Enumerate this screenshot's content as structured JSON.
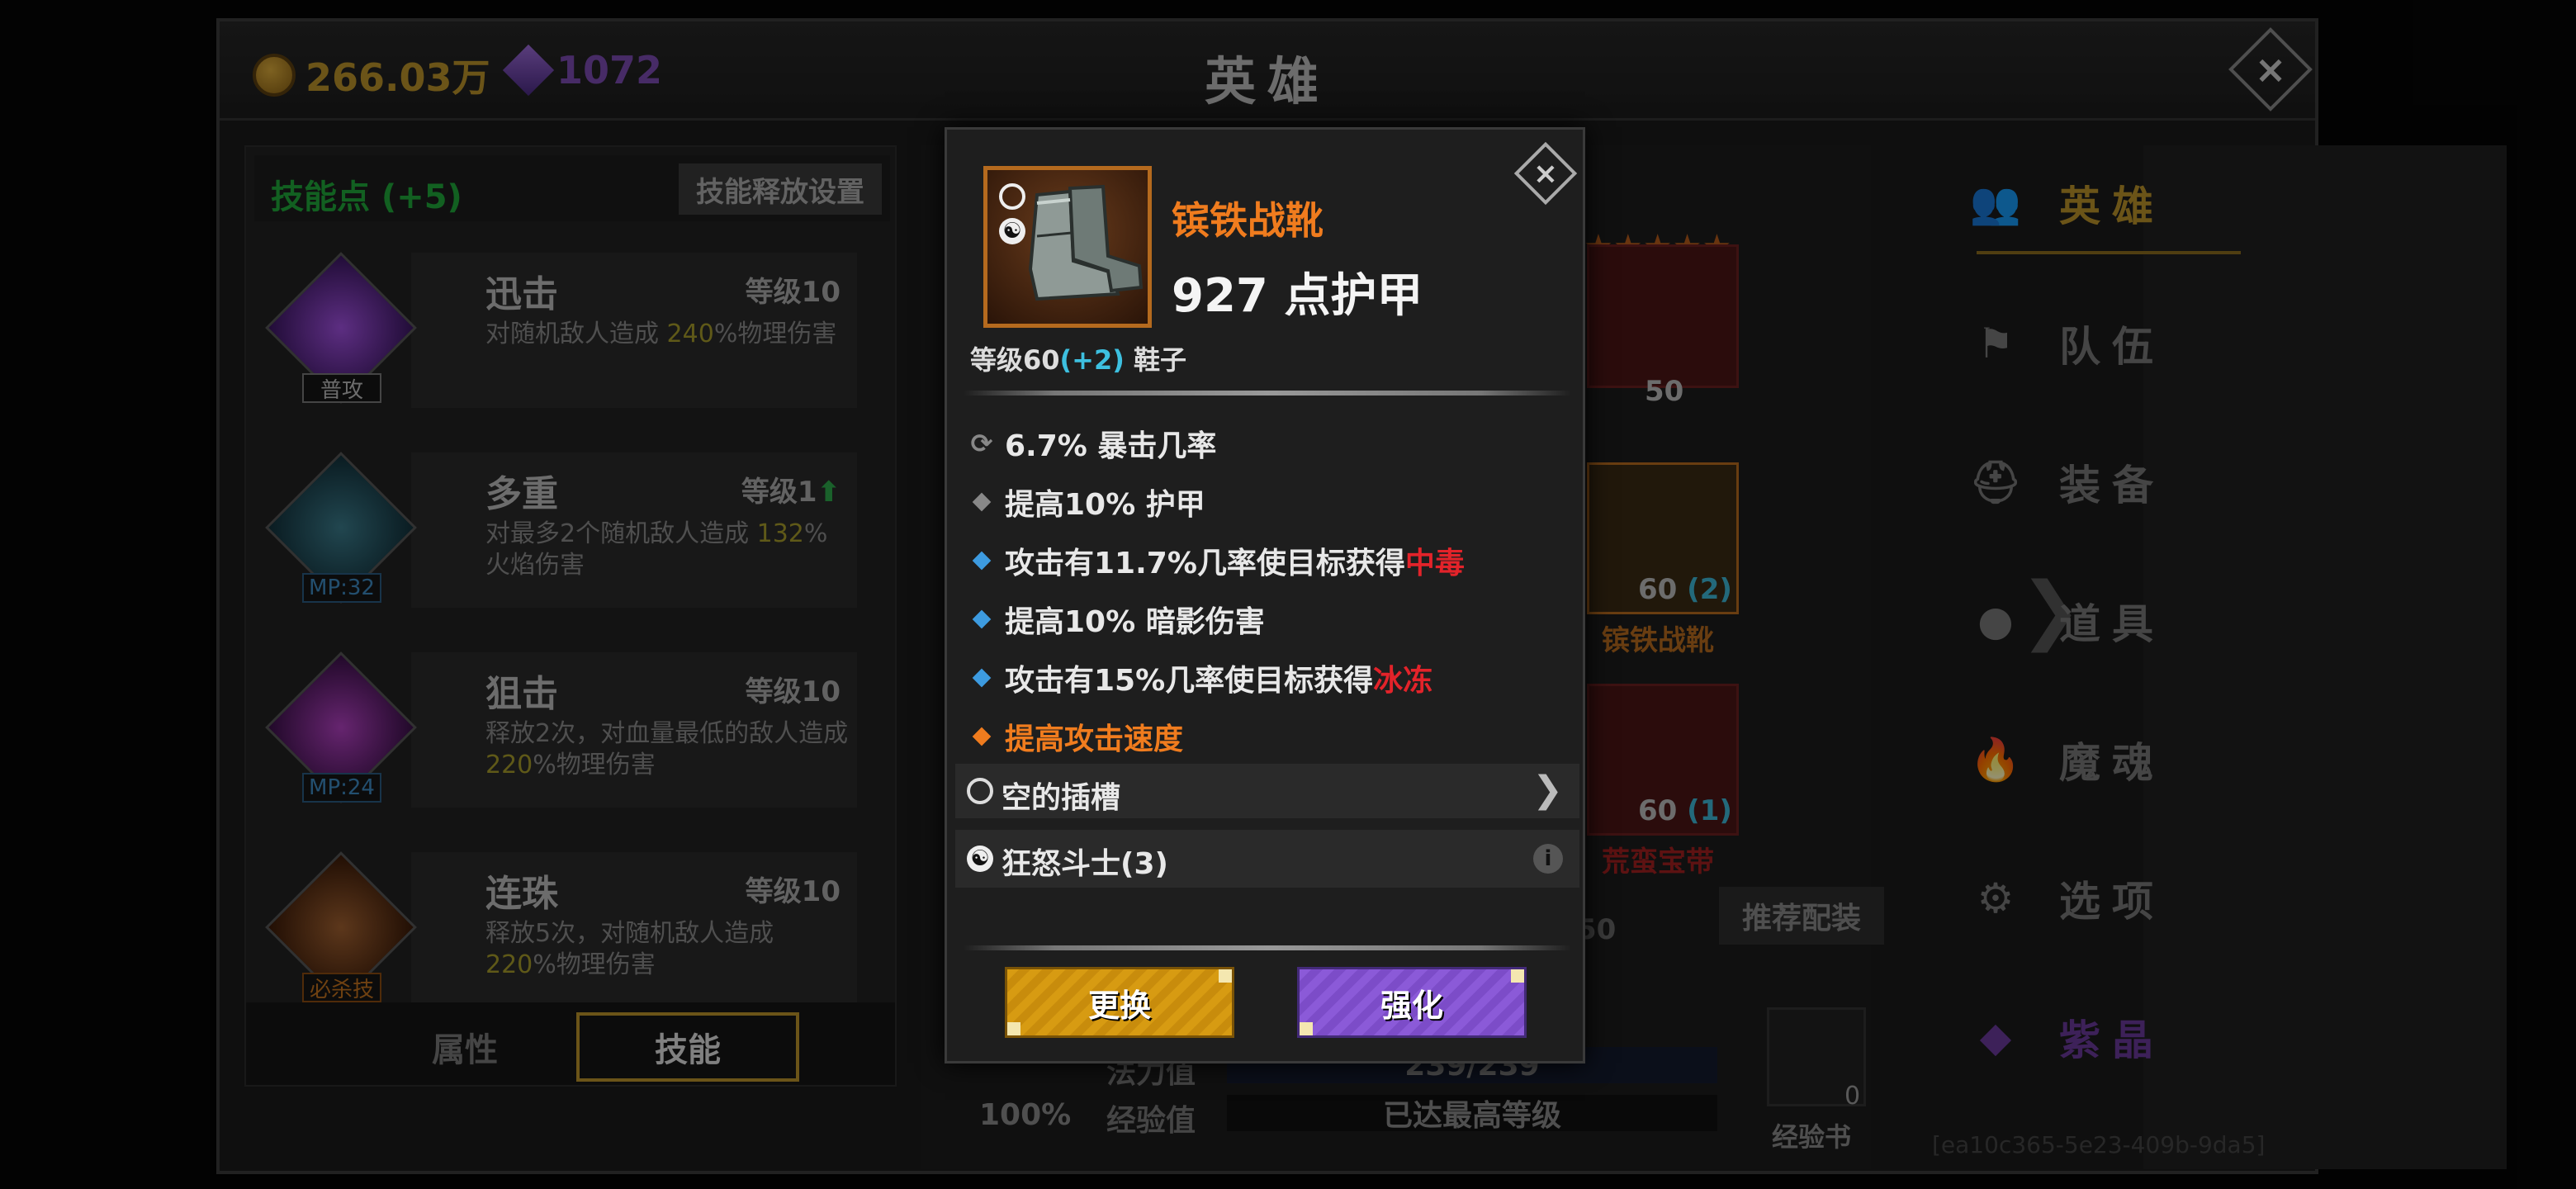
{
  "header": {
    "gold": "266.03万",
    "gems": "1072",
    "title": "英雄",
    "close": "×"
  },
  "left_panel": {
    "skill_points": "技能点 (+5)",
    "release_settings": "技能释放设置",
    "skills": [
      {
        "name": "迅击",
        "level": "等级10",
        "desc_pre": "对随机敌人造成 ",
        "desc_num": "240",
        "desc_post": "%物理伤害",
        "tag": "普攻",
        "color": "#8a3acc"
      },
      {
        "name": "多重",
        "level": "等级1",
        "desc_pre": "对最多2个随机敌人造成 ",
        "desc_num": "132",
        "desc_post": "%火焰伤害",
        "tag": "MP:32",
        "color": "#2a5a6a"
      },
      {
        "name": "狙击",
        "level": "等级10",
        "desc_pre": "释放2次，对血量最低的敌人造成 ",
        "desc_num": "220",
        "desc_post": "%物理伤害",
        "tag": "MP:24",
        "color": "#8a2aa0"
      },
      {
        "name": "连珠",
        "level": "等级10",
        "desc_pre": "释放5次，对随机敌人造成 ",
        "desc_num": "220",
        "desc_post": "%物理伤害",
        "tag": "必杀技",
        "color": "#8a4a1a"
      }
    ],
    "tabs": [
      "属性",
      "技能"
    ]
  },
  "middle": {
    "hero_level": "50",
    "boots_level": "60",
    "boots_bonus": "(2)",
    "boots_name": "镔铁战靴",
    "belt_level": "60",
    "belt_bonus": "(1)",
    "belt_name": "荒蛮宝带",
    "recommend": "推荐配装",
    "partial_level": "50",
    "mana_label": "法力值",
    "mana_value": "239/239",
    "exp_label": "经验值",
    "exp_value": "已达最高等级",
    "percent": "100%",
    "exp_book_label": "经验书",
    "exp_book_count": "0"
  },
  "right_nav": [
    {
      "label": "英雄",
      "icon": "👥",
      "active": true
    },
    {
      "label": "队伍",
      "icon": "⚑",
      "active": false
    },
    {
      "label": "装备",
      "icon": "⛑",
      "active": false
    },
    {
      "label": "道具",
      "icon": "●",
      "active": false
    },
    {
      "label": "魔魂",
      "icon": "🔥",
      "active": false
    },
    {
      "label": "选项",
      "icon": "⚙",
      "active": false
    },
    {
      "label": "紫晶",
      "icon": "◆",
      "active": false
    }
  ],
  "uid_fragment": "[ea10c365-5e23-409b-9da5]",
  "popup": {
    "close": "×",
    "item_name": "镔铁战靴",
    "armor": "927 点护甲",
    "meta_pre": "等级60",
    "meta_bonus": "(+2)",
    "meta_post": " 鞋子",
    "stats": [
      {
        "icon": "⟳",
        "pre": "6.7% 暴击几率",
        "red": "",
        "color": "#888"
      },
      {
        "icon": "◆",
        "pre": "提高10% 护甲",
        "red": "",
        "color": "#888"
      },
      {
        "icon": "◆",
        "pre": "攻击有11.7%几率使目标获得",
        "red": "中毒",
        "color": "#3d9be0"
      },
      {
        "icon": "◆",
        "pre": "提高10% 暗影伤害",
        "red": "",
        "color": "#3d9be0"
      },
      {
        "icon": "◆",
        "pre": "攻击有15%几率使目标获得",
        "red": "冰冻",
        "color": "#3d9be0"
      },
      {
        "icon": "◆",
        "pre": "提高攻击速度",
        "red": "",
        "color": "#f07c1e"
      }
    ],
    "empty_socket": "空的插槽",
    "set_name": "狂怒斗士(3)",
    "swap": "更换",
    "upgrade": "强化"
  }
}
